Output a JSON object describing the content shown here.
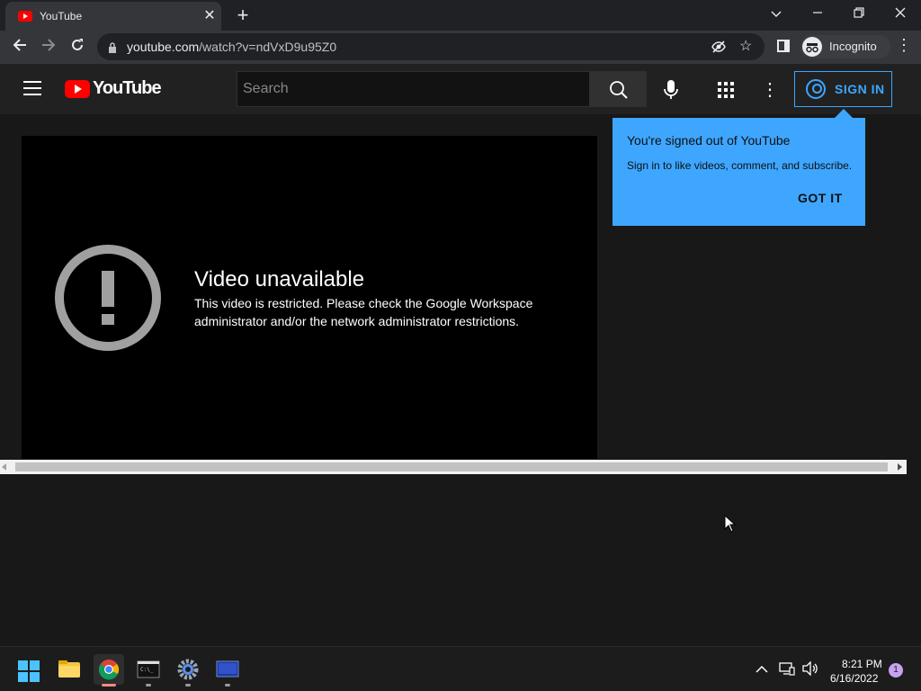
{
  "browser": {
    "tab_title": "YouTube",
    "url_host": "youtube.com",
    "url_path": "/watch?v=ndVxD9u95Z0",
    "profile_label": "Incognito"
  },
  "youtube": {
    "logo_text": "YouTube",
    "search_placeholder": "Search",
    "sign_in_label": "SIGN IN"
  },
  "player": {
    "error_title": "Video unavailable",
    "error_message": "This video is restricted. Please check the Google Workspace administrator and/or the network administrator restrictions."
  },
  "popup": {
    "title": "You're signed out of YouTube",
    "text": "Sign in to like videos, comment, and subscribe.",
    "button": "GOT IT"
  },
  "taskbar": {
    "time": "8:21 PM",
    "date": "6/16/2022",
    "notification_count": "1"
  },
  "colors": {
    "yt_red": "#ff0000",
    "yt_blue": "#3ea6ff",
    "bg": "#181818"
  }
}
